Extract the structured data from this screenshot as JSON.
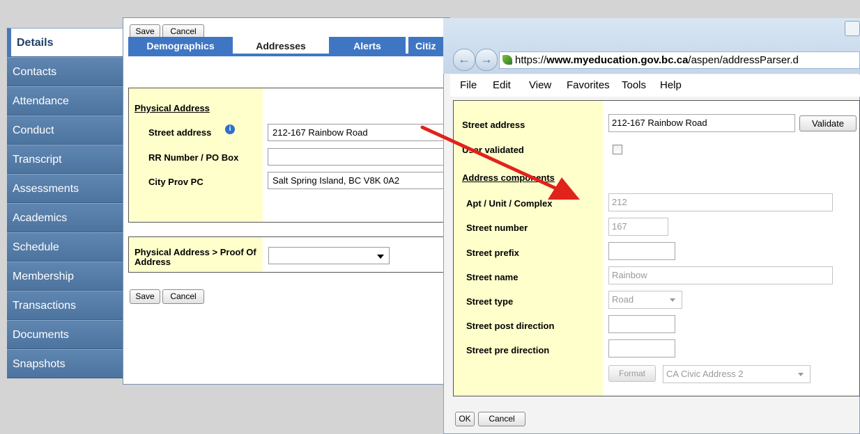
{
  "sidebar": {
    "items": [
      "Details",
      "Contacts",
      "Attendance",
      "Conduct",
      "Transcript",
      "Assessments",
      "Academics",
      "Schedule",
      "Membership",
      "Transactions",
      "Documents",
      "Snapshots"
    ]
  },
  "main": {
    "save_label": "Save",
    "cancel_label": "Cancel",
    "tabs": [
      "Demographics",
      "Addresses",
      "Alerts",
      "Citiz"
    ],
    "physical_address": {
      "heading": "Physical Address",
      "street_label": "Street address",
      "street_value": "212-167 Rainbow Road",
      "rr_label": "RR Number / PO Box",
      "rr_value": "",
      "city_label": "City Prov PC",
      "city_value": "Salt Spring Island, BC V8K 0A2"
    },
    "proof_label": "Physical Address > Proof Of Address",
    "proof_value": ""
  },
  "dialog": {
    "url_secure": "https://",
    "url_domain": "www.myeducation.gov.bc.ca",
    "url_path": "/aspen/addressParser.d",
    "menu": [
      "File",
      "Edit",
      "View",
      "Favorites",
      "Tools",
      "Help"
    ],
    "street_address_label": "Street address",
    "street_address_value": "212-167 Rainbow Road",
    "validate_label": "Validate",
    "user_validated_label": "User validated",
    "components_heading": "Address components",
    "fields": [
      {
        "label": "Apt / Unit / Complex",
        "value": "212"
      },
      {
        "label": "Street number",
        "value": "167"
      },
      {
        "label": "Street prefix",
        "value": ""
      },
      {
        "label": "Street name",
        "value": "Rainbow"
      },
      {
        "label": "Street type",
        "value": "Road"
      },
      {
        "label": "Street post direction",
        "value": ""
      },
      {
        "label": "Street pre direction",
        "value": ""
      }
    ],
    "format_label": "Format",
    "format_select": "CA Civic Address 2",
    "ok_label": "OK",
    "cancel_label": "Cancel"
  },
  "colors": {
    "sidebar": "#4d739f",
    "tab": "#3f76c4",
    "label_background": "#ffffcc",
    "arrow": "#e0231b"
  }
}
